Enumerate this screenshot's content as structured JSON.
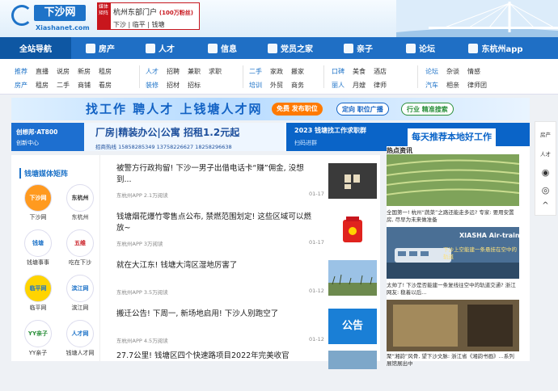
{
  "header": {
    "logo_text": "下沙网",
    "logo_url_text": "Xiashanet.com",
    "media_badge": "媒体矩阵",
    "portal_title": "杭州东部门户",
    "portal_fans": "(100万粉丝)",
    "portal_links": "下沙 | 临平 | 钱塘"
  },
  "nav": [
    {
      "label": "全站导航",
      "icon": ""
    },
    {
      "label": "房产",
      "icon": "home-icon"
    },
    {
      "label": "人才",
      "icon": "user-icon"
    },
    {
      "label": "信息",
      "icon": "shield-icon"
    },
    {
      "label": "党员之家",
      "icon": "people-icon"
    },
    {
      "label": "亲子",
      "icon": "child-icon"
    },
    {
      "label": "论坛",
      "icon": "chat-icon"
    },
    {
      "label": "东杭州app",
      "icon": "phone-icon"
    }
  ],
  "subnav": {
    "g1": [
      "推荐",
      "直播",
      "说房",
      "新房",
      "租房",
      "房产",
      "租房",
      "二手",
      "商铺",
      "看房"
    ],
    "g2": [
      "人才",
      "招聘",
      "兼职",
      "求职",
      "装修",
      "招材",
      "招标"
    ],
    "g3": [
      "二手",
      "家政",
      "搬家",
      "培训",
      "外贸",
      "商务"
    ],
    "g4": [
      "口碑",
      "美食",
      "酒店",
      "丽人",
      "月嫂",
      "律师"
    ],
    "g5": [
      "论坛",
      "杂谈",
      "情感",
      "汽车",
      "相亲",
      "律师团"
    ]
  },
  "banner1": {
    "slogan": "找工作 聘人才 上钱塘人才网",
    "pill1": "免费 发布职位",
    "pill2": "定向 职位广播",
    "pill3": "行业 精准搜索"
  },
  "banner2": {
    "left_line1": "创想邦·AT800",
    "left_line2": "创新中心",
    "headline": "厂房|精装办公|公寓 招租1.2元起",
    "phones": "招商热线 15858285349 13758226627 18258296638",
    "right_small": "2023 钱塘找工作求职群",
    "right_big": "每天推荐本地好工作",
    "right_scan": "扫码进群"
  },
  "matrix": {
    "title": "钱塘媒体矩阵",
    "items": [
      {
        "icon": "下沙网",
        "name": "下沙网",
        "color": "#1e73c8"
      },
      {
        "icon": "东杭州",
        "name": "东杭州",
        "color": "#333333"
      },
      {
        "icon": "钱塘",
        "name": "钱塘事事",
        "color": "#1e73c8"
      },
      {
        "icon": "五维",
        "name": "吃在下沙",
        "color": "#c8161d"
      },
      {
        "icon": "临平网",
        "name": "临平网",
        "color": "#e8a000"
      },
      {
        "icon": "滨江网",
        "name": "滨江网",
        "color": "#1e73c8"
      },
      {
        "icon": "YY亲子",
        "name": "YY亲子",
        "color": "#2a8f3a"
      },
      {
        "icon": "人才网",
        "name": "钱塘人才网",
        "color": "#1e73c8"
      }
    ]
  },
  "feed": [
    {
      "title": "被警方行政拘留! 下沙一男子出借电话卡“赚”佣金, 没想到...",
      "meta": "东杭州APP  2.1万阅读",
      "date": "01-17"
    },
    {
      "title": "钱塘烟花爆竹零售点公布, 禁燃范围划定! 这些区域可以燃放~",
      "meta": "东杭州APP  3万阅读",
      "date": "01-17"
    },
    {
      "title": "就在大江东! 钱塘大湾区湿地厉害了",
      "meta": "东杭州APP  3.5万阅读",
      "date": "01-12"
    },
    {
      "title": "搬迁公告! 下周一, 新场地启用! 下沙人别跑空了",
      "meta": "东杭州APP  4.5万阅读",
      "date": "01-12",
      "img_text": "公告"
    },
    {
      "title": "27.7公里! 钱塘区四个快速路项目2022年完美收官",
      "meta": "",
      "date": ""
    }
  ],
  "right": {
    "header": "热点资讯",
    "captions": [
      "全国第一! 杭州“蔬菜”之路还能走多远? 专家: 要用安置房, 尽早为未来做准备",
      "太帅了! 下沙是否能建一条复线往空中的轨道交通? 浙江网友: 稳着以后...",
      "聚“湘韵”风骨, 望下沙文脉: 浙江省《湘韵书画》...系列展馆展出中"
    ],
    "air_train": "XIASHA Air-train",
    "air_train_sub": "下沙上空能建一条悬挂在空中的轨道"
  },
  "rail": [
    "房产",
    "人才",
    "微信",
    "微博",
    "返回"
  ]
}
